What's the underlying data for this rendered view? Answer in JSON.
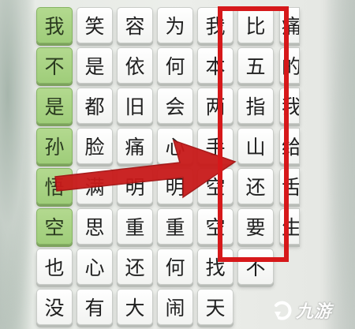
{
  "board": {
    "rows": [
      [
        "我",
        "笑",
        "容",
        "为",
        "我",
        "比",
        "痛"
      ],
      [
        "不",
        "是",
        "依",
        "何",
        "本",
        "五",
        "的"
      ],
      [
        "是",
        "都",
        "旧",
        "会",
        "两",
        "指",
        "我"
      ],
      [
        "孙",
        "脸",
        "痛",
        "心",
        "手",
        "山",
        "给"
      ],
      [
        "悟",
        "满",
        "明",
        "明",
        "空",
        "还",
        "舌"
      ],
      [
        "空",
        "思",
        "重",
        "重",
        "空",
        "要",
        "生"
      ],
      [
        "也",
        "心",
        "还",
        "何",
        "找",
        "不",
        ""
      ],
      [
        "没",
        "有",
        "大",
        "闹",
        "天",
        "",
        ""
      ]
    ],
    "selected_column": 0,
    "selected_row_range": [
      0,
      5
    ],
    "colors": {
      "selected_tile": "#a6d283",
      "highlight_box": "#d6181a",
      "arrow": "#c81a1a"
    }
  },
  "watermark": {
    "text": "九游",
    "icon": "jiuyou-logo-icon"
  }
}
